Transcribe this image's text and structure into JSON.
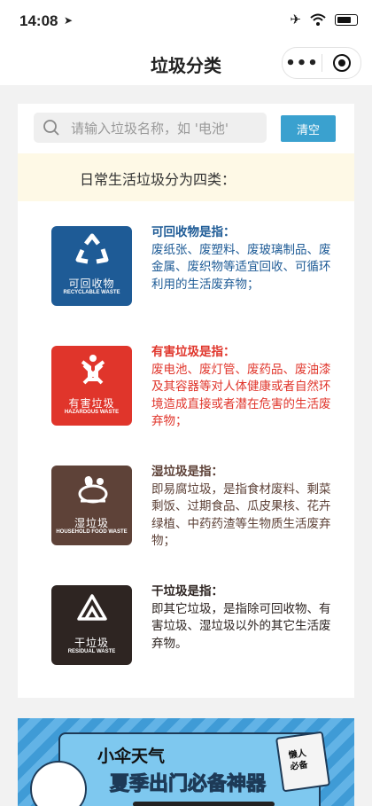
{
  "status_bar": {
    "time": "14:08",
    "location_icon": "location-arrow-icon",
    "icons": [
      "airplane-icon",
      "wifi-icon",
      "battery-icon"
    ]
  },
  "nav": {
    "title": "垃圾分类",
    "more_label": "•••"
  },
  "search": {
    "placeholder": "请输入垃圾名称，如 '电池'",
    "clear_label": "清空"
  },
  "banner": {
    "text": "日常生活垃圾分为四类："
  },
  "categories": [
    {
      "zh": "可回收物",
      "en": "RECYCLABLE WASTE",
      "heading": "可回收物是指：",
      "text": "废纸张、废塑料、废玻璃制品、废金属、废织物等适宜回收、可循环利用的生活废弃物；",
      "color": "#1e5b96",
      "text_color": "#1e5b96",
      "icon": "recycle-icon"
    },
    {
      "zh": "有害垃圾",
      "en": "HAZARDOUS WASTE",
      "heading": "有害垃圾是指：",
      "text": "废电池、废灯管、废药品、废油漆及其容器等对人体健康或者自然环境造成直接或者潜在危害的生活废弃物；",
      "color": "#e0352b",
      "text_color": "#e0352b",
      "icon": "hazard-icon"
    },
    {
      "zh": "湿垃圾",
      "en": "HOUSEHOLD FOOD WASTE",
      "heading": "湿垃圾是指：",
      "text": "即易腐垃圾，是指食材废料、剩菜剩饭、过期食品、瓜皮果核、花卉绿植、中药药渣等生物质生活废弃物；",
      "color": "#5e4238",
      "text_color": "#5e4238",
      "icon": "food-waste-icon"
    },
    {
      "zh": "干垃圾",
      "en": "RESIDUAL WASTE",
      "heading": "干垃圾是指：",
      "text": "即其它垃圾，是指除可回收物、有害垃圾、湿垃圾以外的其它生活废弃物。",
      "color": "#2e2522",
      "text_color": "#2e2522",
      "icon": "residual-icon"
    }
  ],
  "ad": {
    "title": "小伞天气",
    "subtitle": "夏季出门必备神器",
    "note": "懒人\n必备"
  }
}
